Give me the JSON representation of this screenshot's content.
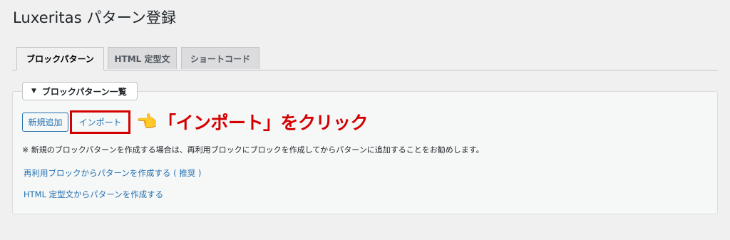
{
  "page": {
    "title": "Luxeritas パターン登録"
  },
  "tabs": [
    {
      "label": "ブロックパターン",
      "active": true
    },
    {
      "label": "HTML 定型文",
      "active": false
    },
    {
      "label": "ショートコード",
      "active": false
    }
  ],
  "section": {
    "toggle_icon": "triangle-down-icon",
    "title": "ブロックパターン一覧"
  },
  "buttons": {
    "add_new": "新規追加",
    "import": "インポート"
  },
  "annotation": {
    "hand_icon": "pointing-hand-icon",
    "hand_glyph": "👈",
    "text": "「インポート」をクリック",
    "color": "#d40000"
  },
  "note": "※ 新規のブロックパターンを作成する場合は、再利用ブロックにブロックを作成してからパターンに追加することをお勧めします。",
  "links": [
    "再利用ブロックからパターンを作成する ( 推奨 )",
    "HTML 定型文からパターンを作成する"
  ],
  "colors": {
    "accent": "#2271b1",
    "highlight": "#d40000",
    "background": "#f0f0f1"
  }
}
